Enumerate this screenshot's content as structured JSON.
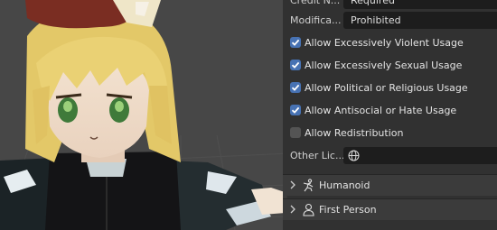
{
  "panel": {
    "credit_row": {
      "label": "Credit N...",
      "value": "Required"
    },
    "modification_row": {
      "label": "Modifica...",
      "value": "Prohibited"
    },
    "checkboxes": [
      {
        "label": "Allow Excessively Violent Usage",
        "checked": true
      },
      {
        "label": "Allow Excessively Sexual Usage",
        "checked": true
      },
      {
        "label": "Allow Political or Religious Usage",
        "checked": true
      },
      {
        "label": "Allow Antisocial or Hate Usage",
        "checked": true
      },
      {
        "label": "Allow Redistribution",
        "checked": false
      }
    ],
    "other_license": {
      "label": "Other Lic...",
      "value": "",
      "icon": "globe-icon"
    },
    "sections": [
      {
        "label": "Humanoid",
        "icon": "humanoid-icon"
      },
      {
        "label": "First Person",
        "icon": "person-icon"
      }
    ]
  },
  "colors": {
    "panel_bg": "#303030",
    "checkbox_on": "#4772b3",
    "field_bg": "#1d1d1d"
  }
}
